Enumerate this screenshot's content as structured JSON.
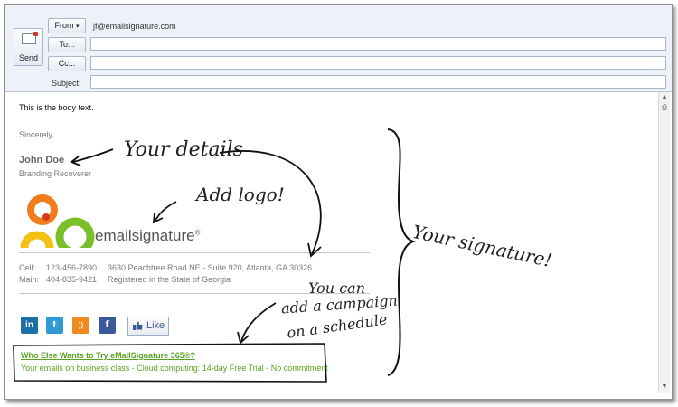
{
  "header": {
    "send_label": "Send",
    "from_label": "From",
    "from_caret": "▾",
    "from_value": "jf@emailsignature.com",
    "to_label": "To...",
    "cc_label": "Cc...",
    "subject_label": "Subject:"
  },
  "body": {
    "text": "This is the body text.",
    "closing": "Sincerely,",
    "name": "John Doe",
    "title": "Branding Recoverer",
    "logo_text": "emailsignature",
    "logo_mark": "®",
    "contact": {
      "cell_label": "Cell:",
      "cell_value": "123-456-7890",
      "main_label": "Main:",
      "main_value": "404-835-9421",
      "address": "3630 Peachtree Road NE - Suite 920, Atlanta, GA 30326",
      "registration": "Registered in the State of Georgia"
    },
    "social": [
      {
        "icon": "linkedin-icon",
        "glyph": "in",
        "color": "#1d6fa8"
      },
      {
        "icon": "twitter-icon",
        "glyph": "t",
        "color": "#2f9bd6"
      },
      {
        "icon": "rss-icon",
        "glyph": "))",
        "color": "#f18a1c"
      },
      {
        "icon": "facebook-icon",
        "glyph": "f",
        "color": "#3b5998"
      }
    ],
    "like_label": "Like",
    "campaign": {
      "link": "Who Else Wants to Try eMailSignature 365®?",
      "text": "Your emails on business class - Cloud computing: 14-day Free Trial - No commitment"
    }
  },
  "annotations": {
    "details": "Your details",
    "logo": "Add logo!",
    "campaign_line1": "You can",
    "campaign_line2": "add a campaign",
    "campaign_line3": "on a schedule",
    "signature": "Your signature!"
  },
  "colors": {
    "campaign_green": "#5aa021",
    "logo_orange": "#f07c1b",
    "logo_green": "#7bbf2a",
    "logo_yellow": "#f3c114",
    "logo_red": "#d83a20"
  }
}
